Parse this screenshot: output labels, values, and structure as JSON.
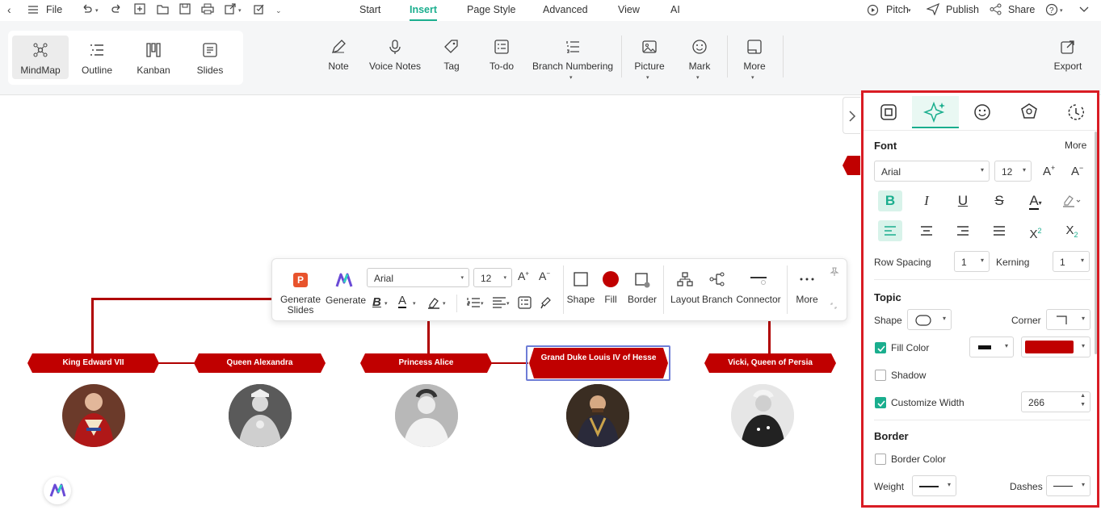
{
  "menubar": {
    "file": "File",
    "tabs": [
      "Start",
      "Insert",
      "Page Style",
      "Advanced",
      "View",
      "AI"
    ],
    "active_tab": "Insert",
    "pitch": "Pitch",
    "publish": "Publish",
    "share": "Share"
  },
  "views": [
    "MindMap",
    "Outline",
    "Kanban",
    "Slides"
  ],
  "ribbon": {
    "note": "Note",
    "voice_notes": "Voice Notes",
    "tag": "Tag",
    "todo": "To-do",
    "branch_numbering": "Branch Numbering",
    "picture": "Picture",
    "mark": "Mark",
    "more": "More",
    "export": "Export"
  },
  "nodes": {
    "n1": "King Edward VII",
    "n2": "Queen Alexandra",
    "n3": "Princess Alice",
    "n4": "Grand Duke Louis IV of Hesse",
    "n5": "Vicki, Queen of Persia"
  },
  "floatbar": {
    "generate_slides": "Generate Slides",
    "generate": "Generate",
    "font": "Arial",
    "size": "12",
    "shape": "Shape",
    "fill": "Fill",
    "border": "Border",
    "layout": "Layout",
    "branch": "Branch",
    "connector": "Connector",
    "more": "More"
  },
  "panel": {
    "font_title": "Font",
    "more": "More",
    "font_name": "Arial",
    "font_size": "12",
    "row_spacing_label": "Row Spacing",
    "row_spacing": "1",
    "kerning_label": "Kerning",
    "kerning": "1",
    "topic_title": "Topic",
    "shape_label": "Shape",
    "corner_label": "Corner",
    "fill_color_label": "Fill Color",
    "shadow_label": "Shadow",
    "custom_width_label": "Customize Width",
    "custom_width": "266",
    "border_title": "Border",
    "border_color_label": "Border Color",
    "weight_label": "Weight",
    "dashes_label": "Dashes",
    "fill_color": "#c00000"
  },
  "colors": {
    "accent": "#1aae8e",
    "node": "#c00000",
    "panel_border": "#d91c24"
  }
}
